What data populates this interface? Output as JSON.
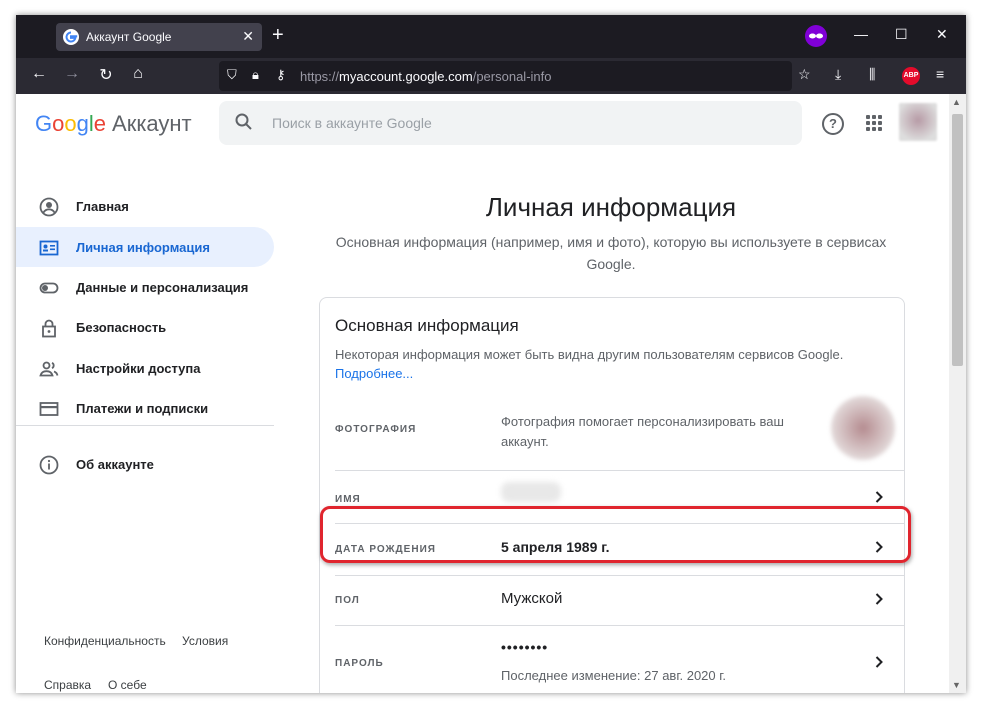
{
  "browser": {
    "tab_title": "Аккаунт Google",
    "tab_close": "✕",
    "new_tab": "+",
    "url_prefix": "https://",
    "url_host": "myaccount.google.com",
    "url_path": "/personal-info",
    "window_controls": {
      "minimize": "—",
      "maximize": "☐",
      "close": "✕"
    },
    "abp_label": "ABP"
  },
  "header": {
    "logo_letters": [
      "G",
      "o",
      "o",
      "g",
      "l",
      "e"
    ],
    "product": "Аккаунт",
    "search_placeholder": "Поиск в аккаунте Google",
    "help_symbol": "?"
  },
  "sidebar": {
    "items": [
      {
        "label": "Главная",
        "icon": "person-circle-icon",
        "active": false
      },
      {
        "label": "Личная информация",
        "icon": "id-card-icon",
        "active": true
      },
      {
        "label": "Данные и персонализация",
        "icon": "toggle-icon",
        "active": false
      },
      {
        "label": "Безопасность",
        "icon": "lock-icon",
        "active": false
      },
      {
        "label": "Настройки доступа",
        "icon": "people-icon",
        "active": false
      },
      {
        "label": "Платежи и подписки",
        "icon": "credit-card-icon",
        "active": false
      },
      {
        "label": "Об аккаунте",
        "icon": "info-icon",
        "active": false
      }
    ],
    "footer": [
      "Конфиденциальность",
      "Условия",
      "Справка",
      "О себе"
    ]
  },
  "main": {
    "title": "Личная информация",
    "description": "Основная информация (например, имя и фото), которую вы используете в сервисах Google.",
    "card": {
      "title": "Основная информация",
      "description": "Некоторая информация может быть видна другим пользователям сервисов Google.",
      "link": "Подробнее...",
      "rows": {
        "photo": {
          "label": "ФОТОГРАФИЯ",
          "text": "Фотография помогает персонализировать ваш аккаунт."
        },
        "name": {
          "label": "ИМЯ"
        },
        "birthday": {
          "label": "ДАТА РОЖДЕНИЯ",
          "value": "5 апреля 1989 г."
        },
        "gender": {
          "label": "ПОЛ",
          "value": "Мужской"
        },
        "password": {
          "label": "ПАРОЛЬ",
          "value": "••••••••",
          "note": "Последнее изменение: 27 авг. 2020 г."
        }
      }
    }
  },
  "colors": {
    "accent": "#1a73e8",
    "active_nav_bg": "#e8f0fe",
    "highlight_border": "#e0252e",
    "browser_dark": "#1c1b22"
  }
}
